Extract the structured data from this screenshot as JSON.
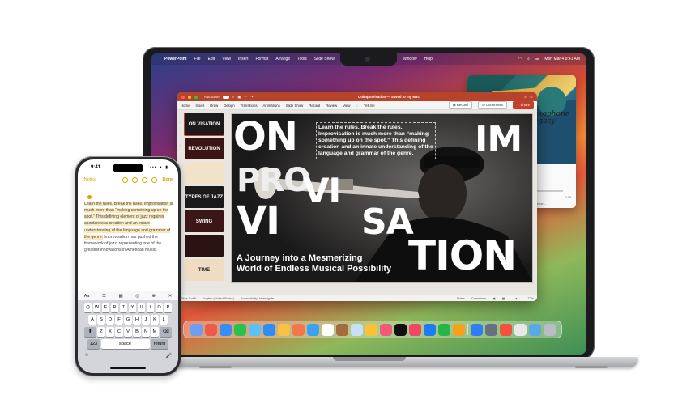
{
  "mac": {
    "menubar": {
      "apple": "",
      "app": "PowerPoint",
      "items": [
        "File",
        "Edit",
        "View",
        "Insert",
        "Format",
        "Arrange",
        "Tools",
        "Slide Show",
        "Window",
        "Help"
      ],
      "clock": "Mon Mar 4  9:41 AM"
    },
    "ppt": {
      "autosave": "AutoSave",
      "doc_title": "Onimprovisation — Saved to my Mac",
      "tabs": [
        "Home",
        "Insert",
        "Draw",
        "Design",
        "Transitions",
        "Animations",
        "Slide Show",
        "Record",
        "Review",
        "View"
      ],
      "tell_me": "Tell me",
      "record": "Record",
      "comments": "Comments",
      "share": "Share",
      "thumbs": [
        {
          "num": "1",
          "label": "ON VISATION"
        },
        {
          "num": "2",
          "label": "REVOLUTION"
        },
        {
          "num": "3",
          "label": ""
        },
        {
          "num": "4",
          "label": "TYPES OF JAZZ"
        },
        {
          "num": "5",
          "label": "SWING"
        },
        {
          "num": "6",
          "label": ""
        },
        {
          "num": "7",
          "label": "TIME"
        }
      ],
      "slide": {
        "words": [
          "ON",
          "PRO",
          "VI",
          "IM",
          "VI",
          "SA",
          "TION"
        ],
        "quote": "Learn the rules. Break the rules. Improvisation is much more than “making something up on the spot.” This defining creation and an innate understanding of the language and grammar of the genre.",
        "quote_mid": "element of jazz requires spontaneous",
        "subtitle_1": "A Journey into a Mesmerizing",
        "subtitle_2": "World of Endless Musical Possibility"
      },
      "status": {
        "slide": "Slide 1 of 8",
        "lang": "English (United States)",
        "access": "Accessibility: Investigate",
        "notes": "Notes",
        "comments": "Comments",
        "zoom": "72%"
      }
    },
    "music": {
      "art_title": "Saxophone Legacy",
      "line1": "Jazz Williams · Sax Legacy",
      "line2": "Jazzphile Sessions",
      "time_left": "",
      "time_right": "-0:29",
      "link": "Jazz Session — Tenor..."
    },
    "dock_colors": [
      "#6e9cf0",
      "#f05a4a",
      "#3a8df5",
      "#29c24a",
      "#5bc0f8",
      "#2f8cf5",
      "#f6c243",
      "#f2784b",
      "#3ba1f7",
      "#ffffff",
      "#a46b3c",
      "#c6e0f7",
      "#fdc134",
      "#f05a7a",
      "#111111",
      "#f24667",
      "#1e7cf3",
      "#27b54a",
      "#f7a01b",
      "#2c7df6",
      "#66707f",
      "#f0523c",
      "#e8e8ea",
      "#58a9e6",
      "#b8bcc4"
    ]
  },
  "phone": {
    "time": "9:41",
    "status": "••• ▲ ▮",
    "back": "Notes",
    "done": "Done",
    "note_highlight": "Learn the rules. Break the rules. Improvisation is much more than “making something up on the spot.” This defining element of jazz requires spontaneous creation and an innate understanding of the language and grammar of the genre.",
    "note_rest": "Improvisation has pushed the framework of jazz, representing one of the greatest innovations in American music.",
    "toolbar": [
      "Aa",
      "☰",
      "▦",
      "◎",
      "⊕",
      "✕"
    ],
    "keys_row1": [
      "Q",
      "W",
      "E",
      "R",
      "T",
      "Y",
      "U",
      "I",
      "O",
      "P"
    ],
    "keys_row2": [
      "A",
      "S",
      "D",
      "F",
      "G",
      "H",
      "J",
      "K",
      "L"
    ],
    "keys_row3": [
      "Z",
      "X",
      "C",
      "V",
      "B",
      "N",
      "M"
    ],
    "shift": "⬆",
    "delete": "⌫",
    "numbers": "123",
    "space": "space",
    "return": "return",
    "emoji": "☺",
    "mic": "🎤"
  }
}
